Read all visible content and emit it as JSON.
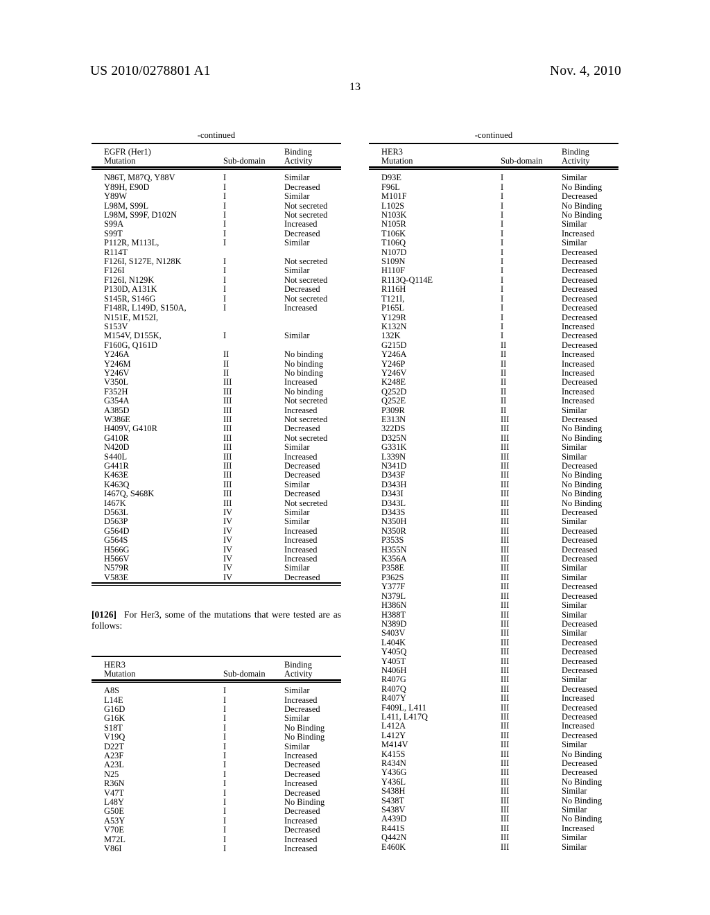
{
  "header": {
    "publication_number": "US 2010/0278801 A1",
    "date": "Nov. 4, 2010",
    "page_number": "13"
  },
  "continued_label": "-continued",
  "tables": {
    "egfr": {
      "title_line1": "EGFR (Her1)",
      "title_line2": "Mutation",
      "col_subdomain": "Sub-domain",
      "col_binding_line1": "Binding",
      "col_binding_line2": "Activity",
      "rows": [
        {
          "mutation": [
            "N86T, M87Q, Y88V"
          ],
          "subdomain": "I",
          "activity": "Similar"
        },
        {
          "mutation": [
            "Y89H, E90D"
          ],
          "subdomain": "I",
          "activity": "Decreased"
        },
        {
          "mutation": [
            "Y89W"
          ],
          "subdomain": "I",
          "activity": "Similar"
        },
        {
          "mutation": [
            "L98M, S99L"
          ],
          "subdomain": "I",
          "activity": "Not secreted"
        },
        {
          "mutation": [
            "L98M, S99F, D102N"
          ],
          "subdomain": "I",
          "activity": "Not secreted"
        },
        {
          "mutation": [
            "S99A"
          ],
          "subdomain": "I",
          "activity": "Increased"
        },
        {
          "mutation": [
            "S99T"
          ],
          "subdomain": "I",
          "activity": "Decreased"
        },
        {
          "mutation": [
            "P112R, M113L,",
            "R114T"
          ],
          "subdomain": "I",
          "activity": "Similar"
        },
        {
          "mutation": [
            "F126I, S127E, N128K"
          ],
          "subdomain": "I",
          "activity": "Not secreted"
        },
        {
          "mutation": [
            "F126I"
          ],
          "subdomain": "I",
          "activity": "Similar"
        },
        {
          "mutation": [
            "F126I, N129K"
          ],
          "subdomain": "I",
          "activity": "Not secreted"
        },
        {
          "mutation": [
            "P130D, A131K"
          ],
          "subdomain": "I",
          "activity": "Decreased"
        },
        {
          "mutation": [
            "S145R, S146G"
          ],
          "subdomain": "I",
          "activity": "Not secreted"
        },
        {
          "mutation": [
            "F148R, L149D, S150A,",
            "N151E, M152I,",
            "S153V"
          ],
          "subdomain": "I",
          "activity": "Increased"
        },
        {
          "mutation": [
            "M154V, D155K,",
            "F160G, Q161D"
          ],
          "subdomain": "I",
          "activity": "Similar"
        },
        {
          "mutation": [
            "Y246A"
          ],
          "subdomain": "II",
          "activity": "No binding"
        },
        {
          "mutation": [
            "Y246M"
          ],
          "subdomain": "II",
          "activity": "No binding"
        },
        {
          "mutation": [
            "Y246V"
          ],
          "subdomain": "II",
          "activity": "No binding"
        },
        {
          "mutation": [
            "V350L"
          ],
          "subdomain": "III",
          "activity": "Increased"
        },
        {
          "mutation": [
            "F352H"
          ],
          "subdomain": "III",
          "activity": "No binding"
        },
        {
          "mutation": [
            "G354A"
          ],
          "subdomain": "III",
          "activity": "Not secreted"
        },
        {
          "mutation": [
            "A385D"
          ],
          "subdomain": "III",
          "activity": "Increased"
        },
        {
          "mutation": [
            "W386E"
          ],
          "subdomain": "III",
          "activity": "Not secreted"
        },
        {
          "mutation": [
            "H409V, G410R"
          ],
          "subdomain": "III",
          "activity": "Decreased"
        },
        {
          "mutation": [
            "G410R"
          ],
          "subdomain": "III",
          "activity": "Not secreted"
        },
        {
          "mutation": [
            "N420D"
          ],
          "subdomain": "III",
          "activity": "Similar"
        },
        {
          "mutation": [
            "S440L"
          ],
          "subdomain": "III",
          "activity": "Increased"
        },
        {
          "mutation": [
            "G441R"
          ],
          "subdomain": "III",
          "activity": "Decreased"
        },
        {
          "mutation": [
            "K463E"
          ],
          "subdomain": "III",
          "activity": "Decreased"
        },
        {
          "mutation": [
            "K463Q"
          ],
          "subdomain": "III",
          "activity": "Similar"
        },
        {
          "mutation": [
            "I467Q, S468K"
          ],
          "subdomain": "III",
          "activity": "Decreased"
        },
        {
          "mutation": [
            "I467K"
          ],
          "subdomain": "III",
          "activity": "Not secreted"
        },
        {
          "mutation": [
            "D563L"
          ],
          "subdomain": "IV",
          "activity": "Similar"
        },
        {
          "mutation": [
            "D563P"
          ],
          "subdomain": "IV",
          "activity": "Similar"
        },
        {
          "mutation": [
            "G564D"
          ],
          "subdomain": "IV",
          "activity": "Increased"
        },
        {
          "mutation": [
            "G564S"
          ],
          "subdomain": "IV",
          "activity": "Increased"
        },
        {
          "mutation": [
            "H566G"
          ],
          "subdomain": "IV",
          "activity": "Increased"
        },
        {
          "mutation": [
            "H566V"
          ],
          "subdomain": "IV",
          "activity": "Increased"
        },
        {
          "mutation": [
            "N579R"
          ],
          "subdomain": "IV",
          "activity": "Similar"
        },
        {
          "mutation": [
            "V583E"
          ],
          "subdomain": "IV",
          "activity": "Decreased"
        }
      ]
    },
    "her3_left": {
      "title_line1": "HER3",
      "title_line2": "Mutation",
      "col_subdomain": "Sub-domain",
      "col_binding_line1": "Binding",
      "col_binding_line2": "Activity",
      "rows": [
        {
          "mutation": [
            "A8S"
          ],
          "subdomain": "I",
          "activity": "Similar"
        },
        {
          "mutation": [
            "L14E"
          ],
          "subdomain": "I",
          "activity": "Increased"
        },
        {
          "mutation": [
            "G16D"
          ],
          "subdomain": "I",
          "activity": "Decreased"
        },
        {
          "mutation": [
            "G16K"
          ],
          "subdomain": "I",
          "activity": "Similar"
        },
        {
          "mutation": [
            "S18T"
          ],
          "subdomain": "I",
          "activity": "No Binding"
        },
        {
          "mutation": [
            "V19Q"
          ],
          "subdomain": "I",
          "activity": "No Binding"
        },
        {
          "mutation": [
            "D22T"
          ],
          "subdomain": "I",
          "activity": "Similar"
        },
        {
          "mutation": [
            "A23F"
          ],
          "subdomain": "I",
          "activity": "Increased"
        },
        {
          "mutation": [
            "A23L"
          ],
          "subdomain": "I",
          "activity": "Decreased"
        },
        {
          "mutation": [
            "N25"
          ],
          "subdomain": "I",
          "activity": "Decreased"
        },
        {
          "mutation": [
            "R36N"
          ],
          "subdomain": "I",
          "activity": "Increased"
        },
        {
          "mutation": [
            "V47T"
          ],
          "subdomain": "I",
          "activity": "Decreased"
        },
        {
          "mutation": [
            "L48Y"
          ],
          "subdomain": "I",
          "activity": "No Binding"
        },
        {
          "mutation": [
            "G50E"
          ],
          "subdomain": "I",
          "activity": "Decreased"
        },
        {
          "mutation": [
            "A53Y"
          ],
          "subdomain": "I",
          "activity": "Increased"
        },
        {
          "mutation": [
            "V70E"
          ],
          "subdomain": "I",
          "activity": "Decreased"
        },
        {
          "mutation": [
            "M72L"
          ],
          "subdomain": "I",
          "activity": "Increased"
        },
        {
          "mutation": [
            "V86I"
          ],
          "subdomain": "I",
          "activity": "Increased"
        }
      ]
    },
    "her3_right": {
      "title_line1": "HER3",
      "title_line2": "Mutation",
      "col_subdomain": "Sub-domain",
      "col_binding_line1": "Binding",
      "col_binding_line2": "Activity",
      "rows": [
        {
          "mutation": [
            "D93E"
          ],
          "subdomain": "I",
          "activity": "Similar"
        },
        {
          "mutation": [
            "F96L"
          ],
          "subdomain": "I",
          "activity": "No Binding"
        },
        {
          "mutation": [
            "M101F"
          ],
          "subdomain": "I",
          "activity": "Decreased"
        },
        {
          "mutation": [
            "L102S"
          ],
          "subdomain": "I",
          "activity": "No Binding"
        },
        {
          "mutation": [
            "N103K"
          ],
          "subdomain": "I",
          "activity": "No Binding"
        },
        {
          "mutation": [
            "N105R"
          ],
          "subdomain": "I",
          "activity": "Similar"
        },
        {
          "mutation": [
            "T106K"
          ],
          "subdomain": "I",
          "activity": "Increased"
        },
        {
          "mutation": [
            "T106Q"
          ],
          "subdomain": "I",
          "activity": "Similar"
        },
        {
          "mutation": [
            "N107D"
          ],
          "subdomain": "I",
          "activity": "Decreased"
        },
        {
          "mutation": [
            "S109N"
          ],
          "subdomain": "I",
          "activity": "Decreased"
        },
        {
          "mutation": [
            "H110F"
          ],
          "subdomain": "I",
          "activity": "Decreased"
        },
        {
          "mutation": [
            "R113Q-Q114E"
          ],
          "subdomain": "I",
          "activity": "Decreased"
        },
        {
          "mutation": [
            "R116H"
          ],
          "subdomain": "I",
          "activity": "Decreased"
        },
        {
          "mutation": [
            "T121I,"
          ],
          "subdomain": "I",
          "activity": "Decreased"
        },
        {
          "mutation": [
            "P165L"
          ],
          "subdomain": "I",
          "activity": "Decreased"
        },
        {
          "mutation": [
            "Y129R"
          ],
          "subdomain": "I",
          "activity": "Decreased"
        },
        {
          "mutation": [
            "K132N"
          ],
          "subdomain": "I",
          "activity": "Increased"
        },
        {
          "mutation": [
            "132K"
          ],
          "subdomain": "I",
          "activity": "Decreased"
        },
        {
          "mutation": [
            "G215D"
          ],
          "subdomain": "II",
          "activity": "Decreased"
        },
        {
          "mutation": [
            "Y246A"
          ],
          "subdomain": "II",
          "activity": "Increased"
        },
        {
          "mutation": [
            "Y246P"
          ],
          "subdomain": "II",
          "activity": "Increased"
        },
        {
          "mutation": [
            "Y246V"
          ],
          "subdomain": "II",
          "activity": "Increased"
        },
        {
          "mutation": [
            "K248E"
          ],
          "subdomain": "II",
          "activity": "Decreased"
        },
        {
          "mutation": [
            "Q252D"
          ],
          "subdomain": "II",
          "activity": "Increased"
        },
        {
          "mutation": [
            "Q252E"
          ],
          "subdomain": "II",
          "activity": "Increased"
        },
        {
          "mutation": [
            "P309R"
          ],
          "subdomain": "II",
          "activity": "Similar"
        },
        {
          "mutation": [
            "E313N"
          ],
          "subdomain": "III",
          "activity": "Decreased"
        },
        {
          "mutation": [
            "322DS"
          ],
          "subdomain": "III",
          "activity": "No Binding"
        },
        {
          "mutation": [
            "D325N"
          ],
          "subdomain": "III",
          "activity": "No Binding"
        },
        {
          "mutation": [
            "G331K"
          ],
          "subdomain": "III",
          "activity": "Similar"
        },
        {
          "mutation": [
            "L339N"
          ],
          "subdomain": "III",
          "activity": "Similar"
        },
        {
          "mutation": [
            "N341D"
          ],
          "subdomain": "III",
          "activity": "Decreased"
        },
        {
          "mutation": [
            "D343F"
          ],
          "subdomain": "III",
          "activity": "No Binding"
        },
        {
          "mutation": [
            "D343H"
          ],
          "subdomain": "III",
          "activity": "No Binding"
        },
        {
          "mutation": [
            "D343I"
          ],
          "subdomain": "III",
          "activity": "No Binding"
        },
        {
          "mutation": [
            "D343L"
          ],
          "subdomain": "III",
          "activity": "No Binding"
        },
        {
          "mutation": [
            "D343S"
          ],
          "subdomain": "III",
          "activity": "Decreased"
        },
        {
          "mutation": [
            "N350H"
          ],
          "subdomain": "III",
          "activity": "Similar"
        },
        {
          "mutation": [
            "N350R"
          ],
          "subdomain": "III",
          "activity": "Decreased"
        },
        {
          "mutation": [
            "P353S"
          ],
          "subdomain": "III",
          "activity": "Decreased"
        },
        {
          "mutation": [
            "H355N"
          ],
          "subdomain": "III",
          "activity": "Decreased"
        },
        {
          "mutation": [
            "K356A"
          ],
          "subdomain": "III",
          "activity": "Decreased"
        },
        {
          "mutation": [
            "P358E"
          ],
          "subdomain": "III",
          "activity": "Similar"
        },
        {
          "mutation": [
            "P362S"
          ],
          "subdomain": "III",
          "activity": "Similar"
        },
        {
          "mutation": [
            "Y377F"
          ],
          "subdomain": "III",
          "activity": "Decreased"
        },
        {
          "mutation": [
            "N379L"
          ],
          "subdomain": "III",
          "activity": "Decreased"
        },
        {
          "mutation": [
            "H386N"
          ],
          "subdomain": "III",
          "activity": "Similar"
        },
        {
          "mutation": [
            "H388T"
          ],
          "subdomain": "III",
          "activity": "Similar"
        },
        {
          "mutation": [
            "N389D"
          ],
          "subdomain": "III",
          "activity": "Decreased"
        },
        {
          "mutation": [
            "S403V"
          ],
          "subdomain": "III",
          "activity": "Similar"
        },
        {
          "mutation": [
            "L404K"
          ],
          "subdomain": "III",
          "activity": "Decreased"
        },
        {
          "mutation": [
            "Y405Q"
          ],
          "subdomain": "III",
          "activity": "Decreased"
        },
        {
          "mutation": [
            "Y405T"
          ],
          "subdomain": "III",
          "activity": "Decreased"
        },
        {
          "mutation": [
            "N406H"
          ],
          "subdomain": "III",
          "activity": "Decreased"
        },
        {
          "mutation": [
            "R407G"
          ],
          "subdomain": "III",
          "activity": "Similar"
        },
        {
          "mutation": [
            "R407Q"
          ],
          "subdomain": "III",
          "activity": "Decreased"
        },
        {
          "mutation": [
            "R407Y"
          ],
          "subdomain": "III",
          "activity": "Increased"
        },
        {
          "mutation": [
            "F409L, L411"
          ],
          "subdomain": "III",
          "activity": "Decreased"
        },
        {
          "mutation": [
            "L411, L417Q"
          ],
          "subdomain": "III",
          "activity": "Decreased"
        },
        {
          "mutation": [
            "L412A"
          ],
          "subdomain": "III",
          "activity": "Increased"
        },
        {
          "mutation": [
            "L412Y"
          ],
          "subdomain": "III",
          "activity": "Decreased"
        },
        {
          "mutation": [
            "M414V"
          ],
          "subdomain": "III",
          "activity": "Similar"
        },
        {
          "mutation": [
            "K415S"
          ],
          "subdomain": "III",
          "activity": "No Binding"
        },
        {
          "mutation": [
            "R434N"
          ],
          "subdomain": "III",
          "activity": "Decreased"
        },
        {
          "mutation": [
            "Y436G"
          ],
          "subdomain": "III",
          "activity": "Decreased"
        },
        {
          "mutation": [
            "Y436L"
          ],
          "subdomain": "III",
          "activity": "No Binding"
        },
        {
          "mutation": [
            "S438H"
          ],
          "subdomain": "III",
          "activity": "Similar"
        },
        {
          "mutation": [
            "S438T"
          ],
          "subdomain": "III",
          "activity": "No Binding"
        },
        {
          "mutation": [
            "S438V"
          ],
          "subdomain": "III",
          "activity": "Similar"
        },
        {
          "mutation": [
            "A439D"
          ],
          "subdomain": "III",
          "activity": "No Binding"
        },
        {
          "mutation": [
            "R441S"
          ],
          "subdomain": "III",
          "activity": "Increased"
        },
        {
          "mutation": [
            "Q442N"
          ],
          "subdomain": "III",
          "activity": "Similar"
        },
        {
          "mutation": [
            "E460K"
          ],
          "subdomain": "III",
          "activity": "Similar"
        }
      ]
    }
  },
  "paragraph": {
    "number": "[0126]",
    "text": "For Her3, some of the mutations that were tested are as follows:"
  }
}
